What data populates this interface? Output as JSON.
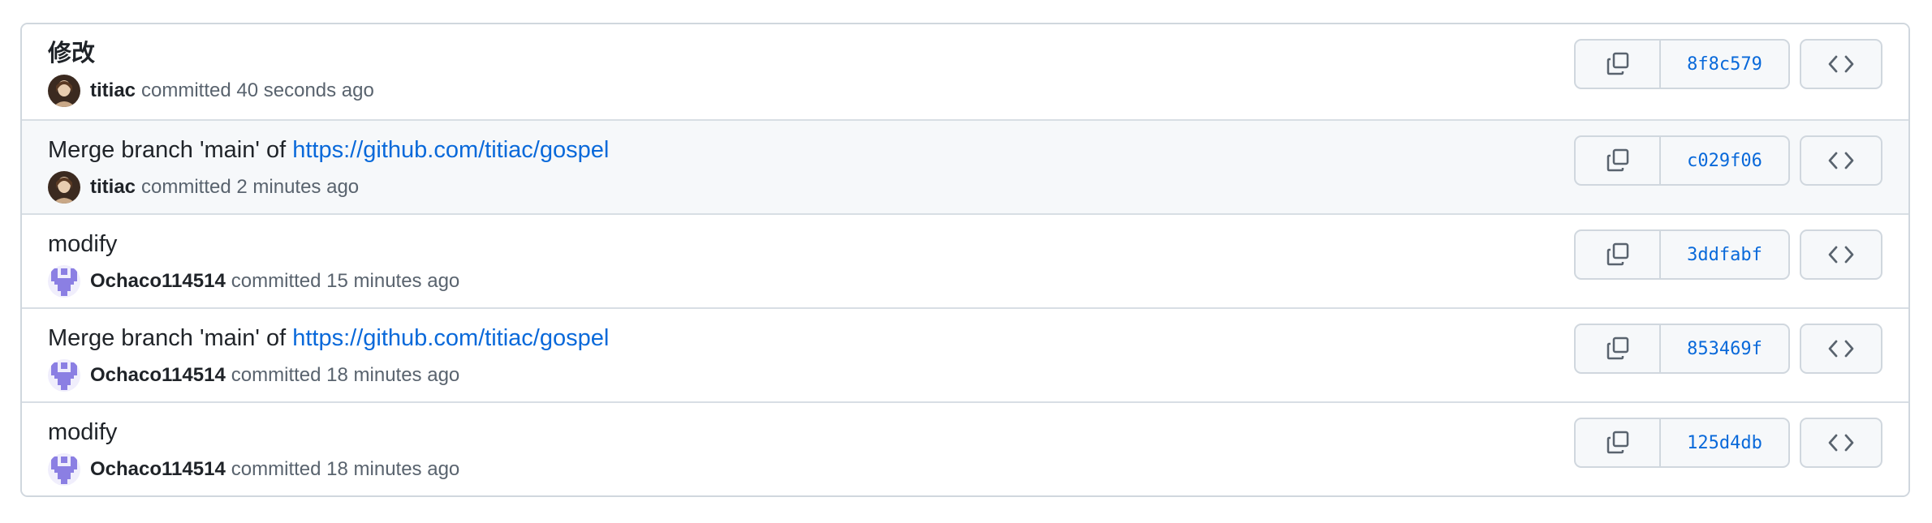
{
  "commits": [
    {
      "title_plain": "修改",
      "title_link": "",
      "author": "titiac",
      "time_text": "committed 40 seconds ago",
      "sha": "8f8c579",
      "avatar": "portrait-avatar"
    },
    {
      "title_plain": "Merge branch 'main' of ",
      "title_link": "https://github.com/titiac/gospel",
      "author": "titiac",
      "time_text": "committed 2 minutes ago",
      "sha": "c029f06",
      "avatar": "portrait-avatar"
    },
    {
      "title_plain": "modify",
      "title_link": "",
      "author": "Ochaco114514",
      "time_text": "committed 15 minutes ago",
      "sha": "3ddfabf",
      "avatar": "identicon-avatar"
    },
    {
      "title_plain": "Merge branch 'main' of ",
      "title_link": "https://github.com/titiac/gospel",
      "author": "Ochaco114514",
      "time_text": "committed 18 minutes ago",
      "sha": "853469f",
      "avatar": "identicon-avatar"
    },
    {
      "title_plain": "modify",
      "title_link": "",
      "author": "Ochaco114514",
      "time_text": "committed 18 minutes ago",
      "sha": "125d4db",
      "avatar": "identicon-avatar"
    }
  ],
  "icons": {
    "copy": "copy-icon",
    "browse": "code-icon"
  },
  "colors": {
    "link": "#0969da",
    "identicon": "#8b7fe3",
    "hover_row": "#f6f8fa"
  }
}
